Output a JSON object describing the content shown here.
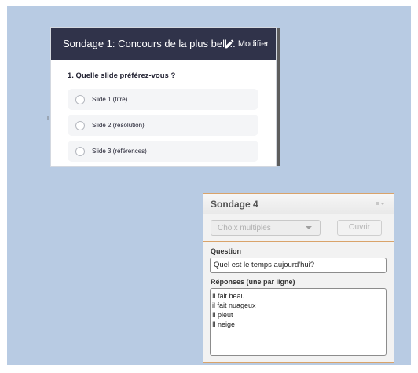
{
  "poll1": {
    "title": "Sondage 1: Concours de la plus bell...",
    "edit_label": "Modifier",
    "question": "1. Quelle slide préférez-vous ?",
    "options": [
      "Slide 1 (titre)",
      "Slide 2 (résolution)",
      "Slide 3 (références)"
    ],
    "colors": {
      "header": "#30334a",
      "option_bg": "#f4f5f7"
    }
  },
  "poll2": {
    "title": "Sondage 4",
    "type_select": "Choix multiples",
    "open_label": "Ouvrir",
    "question_label": "Question",
    "question_value": "Quel est le temps aujourd'hui?",
    "answers_label": "Réponses (une par ligne)",
    "answers": [
      "Il fait beau",
      "il fait nuageux",
      "Il pleut",
      "Il neige"
    ],
    "colors": {
      "border": "#d9a36a"
    }
  },
  "background": {
    "color": "#b8cbe3"
  },
  "icons": {
    "edit": "pencil-icon",
    "menu": "grip-icon"
  }
}
